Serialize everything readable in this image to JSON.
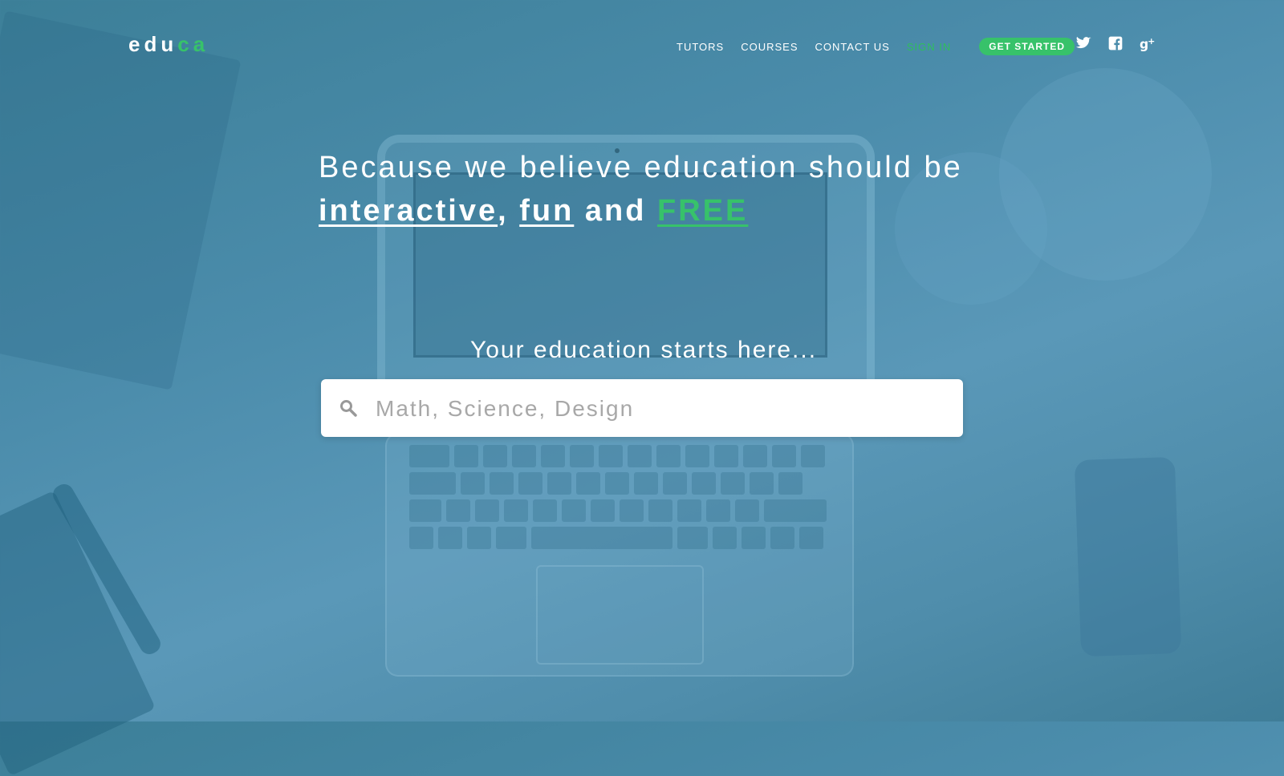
{
  "logo": {
    "text_main": "edu",
    "text_accent": "ca"
  },
  "nav": {
    "items": [
      {
        "label": "TUTORS"
      },
      {
        "label": "COURSES"
      },
      {
        "label": "CONTACT US"
      },
      {
        "label": "SIGN IN"
      }
    ],
    "cta_label": "GET STARTED"
  },
  "social": [
    "twitter-icon",
    "facebook-icon",
    "google-plus-icon"
  ],
  "hero": {
    "line1": "Because we believe education should be",
    "word1": "interactive",
    "sep1": ",",
    "word2": "fun",
    "and": "and",
    "word3": "FREE"
  },
  "search": {
    "tagline": "Your education starts here...",
    "placeholder": "Math, Science, Design"
  },
  "colors": {
    "accent": "#37c26a",
    "background": "#4b8cab"
  }
}
